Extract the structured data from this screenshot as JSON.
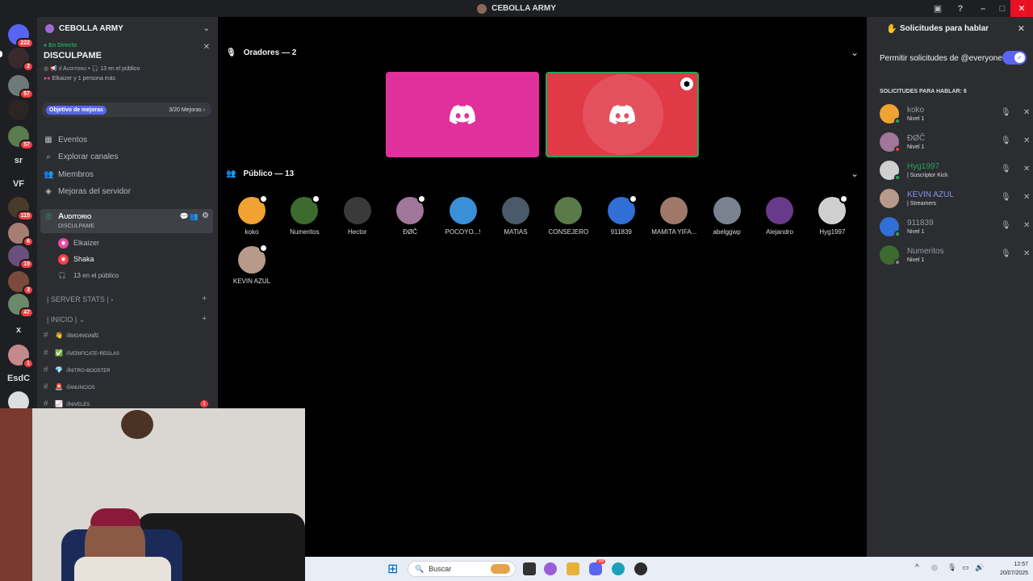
{
  "window": {
    "title": "CEBOLLA ARMY"
  },
  "guilds": [
    {
      "label": "",
      "badge": "222",
      "color": "#5865f2"
    },
    {
      "label": "",
      "badge": "2",
      "color": "#3a2a2e"
    },
    {
      "label": "",
      "badge": "57",
      "color": "#6f7a78"
    },
    {
      "label": "",
      "badge": "",
      "color": "#2d2424"
    },
    {
      "label": "",
      "badge": "57",
      "color": "#5b7a4d"
    },
    {
      "label": "sr",
      "badge": "",
      "color": "#1e1f22"
    },
    {
      "label": "VF",
      "badge": "",
      "color": "#1e1f22"
    },
    {
      "label": "",
      "badge": "115",
      "color": "#4a3a2a"
    },
    {
      "label": "",
      "badge": "6",
      "color": "#a67d72"
    },
    {
      "label": "",
      "badge": "19",
      "color": "#6a4f7d"
    },
    {
      "label": "",
      "badge": "3",
      "color": "#7a4b3c"
    },
    {
      "label": "",
      "badge": "47",
      "color": "#6b8a6a"
    },
    {
      "label": "x",
      "badge": "",
      "color": "#1e1f22"
    },
    {
      "label": "",
      "badge": "1",
      "color": "#c48a8a"
    },
    {
      "label": "EsdC",
      "badge": "",
      "color": "#1e1f22"
    },
    {
      "label": "",
      "badge": "",
      "color": "#dbdee1"
    }
  ],
  "server": {
    "name": "CEBOLLA ARMY",
    "live": {
      "tag": "En Directo",
      "title": "DISCULPAME",
      "channel": "Auditorio",
      "audience": "13 en el público",
      "speakers": "Elkaizer y 1 persona más"
    },
    "goal": {
      "label": "Objetivo de mejoras",
      "progress": "3/20 Mejoras"
    },
    "nav": [
      {
        "label": "Eventos",
        "icon": "calendar-icon"
      },
      {
        "label": "Explorar canales",
        "icon": "compass-icon"
      },
      {
        "label": "Miembros",
        "icon": "members-icon"
      },
      {
        "label": "Mejoras del servidor",
        "icon": "boost-icon"
      }
    ],
    "voice_channel": {
      "name": "Auditorio",
      "topic": "DISCULPAME",
      "users": [
        "Elkaizer",
        "Shaka"
      ],
      "audience": "13 en el público"
    },
    "categories": [
      "SERVER STATS",
      "INICIO"
    ],
    "channels": [
      {
        "name": "вιєиνєиι∂σ",
        "emoji": "👋",
        "badge": ""
      },
      {
        "name": "verificate-reglas",
        "emoji": "✅",
        "badge": ""
      },
      {
        "name": "nitro-booster",
        "emoji": "💎",
        "badge": ""
      },
      {
        "name": "anuncios",
        "emoji": "🚨",
        "badge": ""
      },
      {
        "name": "niveles",
        "emoji": "📈",
        "badge": "1"
      }
    ]
  },
  "stage": {
    "speakers_header": "Oradores — 2",
    "audience_header": "Público — 13",
    "audience": [
      {
        "name": "koko",
        "color": "#f0a232",
        "badge": true
      },
      {
        "name": "Numeritos",
        "color": "#3d6b2f",
        "badge": true
      },
      {
        "name": "Hector",
        "color": "#3a3a3a",
        "badge": false
      },
      {
        "name": "ÐØČ",
        "color": "#a0769a",
        "badge": true
      },
      {
        "name": "POCOYO...!",
        "color": "#3a8fd9",
        "badge": false
      },
      {
        "name": "MATIAS",
        "color": "#4a5a6a",
        "badge": false
      },
      {
        "name": "CONSEJERO",
        "color": "#5a7a4a",
        "badge": false
      },
      {
        "name": "911839",
        "color": "#2f6fd6",
        "badge": true
      },
      {
        "name": "MAMITA YIFA...",
        "color": "#a0786a",
        "badge": false
      },
      {
        "name": "abelggwp",
        "color": "#7a8290",
        "badge": false
      },
      {
        "name": "Alejandro",
        "color": "#6a3a8a",
        "badge": false
      },
      {
        "name": "Hyg1997",
        "color": "#cfcfcf",
        "badge": true
      },
      {
        "name": "KEVIN AZUL",
        "color": "#b89a8a",
        "badge": true
      }
    ]
  },
  "requests": {
    "title": "Solicitudes para hablar",
    "toggle_label": "Permitir solicitudes de @everyone",
    "toggle_on": true,
    "count_label": "SOLICITUDES PARA HABLAR: 6",
    "items": [
      {
        "name": "koko",
        "level": "Nivel 1",
        "avatar": "#f0a232",
        "status": "#23a559",
        "name_color": "#949ba4"
      },
      {
        "name": "ÐØČ",
        "level": "Nivel 1",
        "avatar": "#a0769a",
        "status": "#f23f43",
        "name_color": "#949ba4"
      },
      {
        "name": "Hyg1997",
        "level": "| Suscriptor Kick",
        "avatar": "#cfcfcf",
        "status": "#23a559",
        "name_color": "#23a559"
      },
      {
        "name": "KEVIN AZUL",
        "level": "| Streamers",
        "avatar": "#b89a8a",
        "status": "",
        "name_color": "#8c8ff2"
      },
      {
        "name": "911839",
        "level": "Nivel 1",
        "avatar": "#2f6fd6",
        "status": "#23a559",
        "name_color": "#949ba4"
      },
      {
        "name": "Numeritos",
        "level": "Nivel 1",
        "avatar": "#3d6b2f",
        "status": "#80848e",
        "name_color": "#949ba4"
      }
    ]
  },
  "taskbar": {
    "search_placeholder": "Buscar",
    "time": "12:57",
    "date": "20/07/2025",
    "discord_badge": "99"
  }
}
